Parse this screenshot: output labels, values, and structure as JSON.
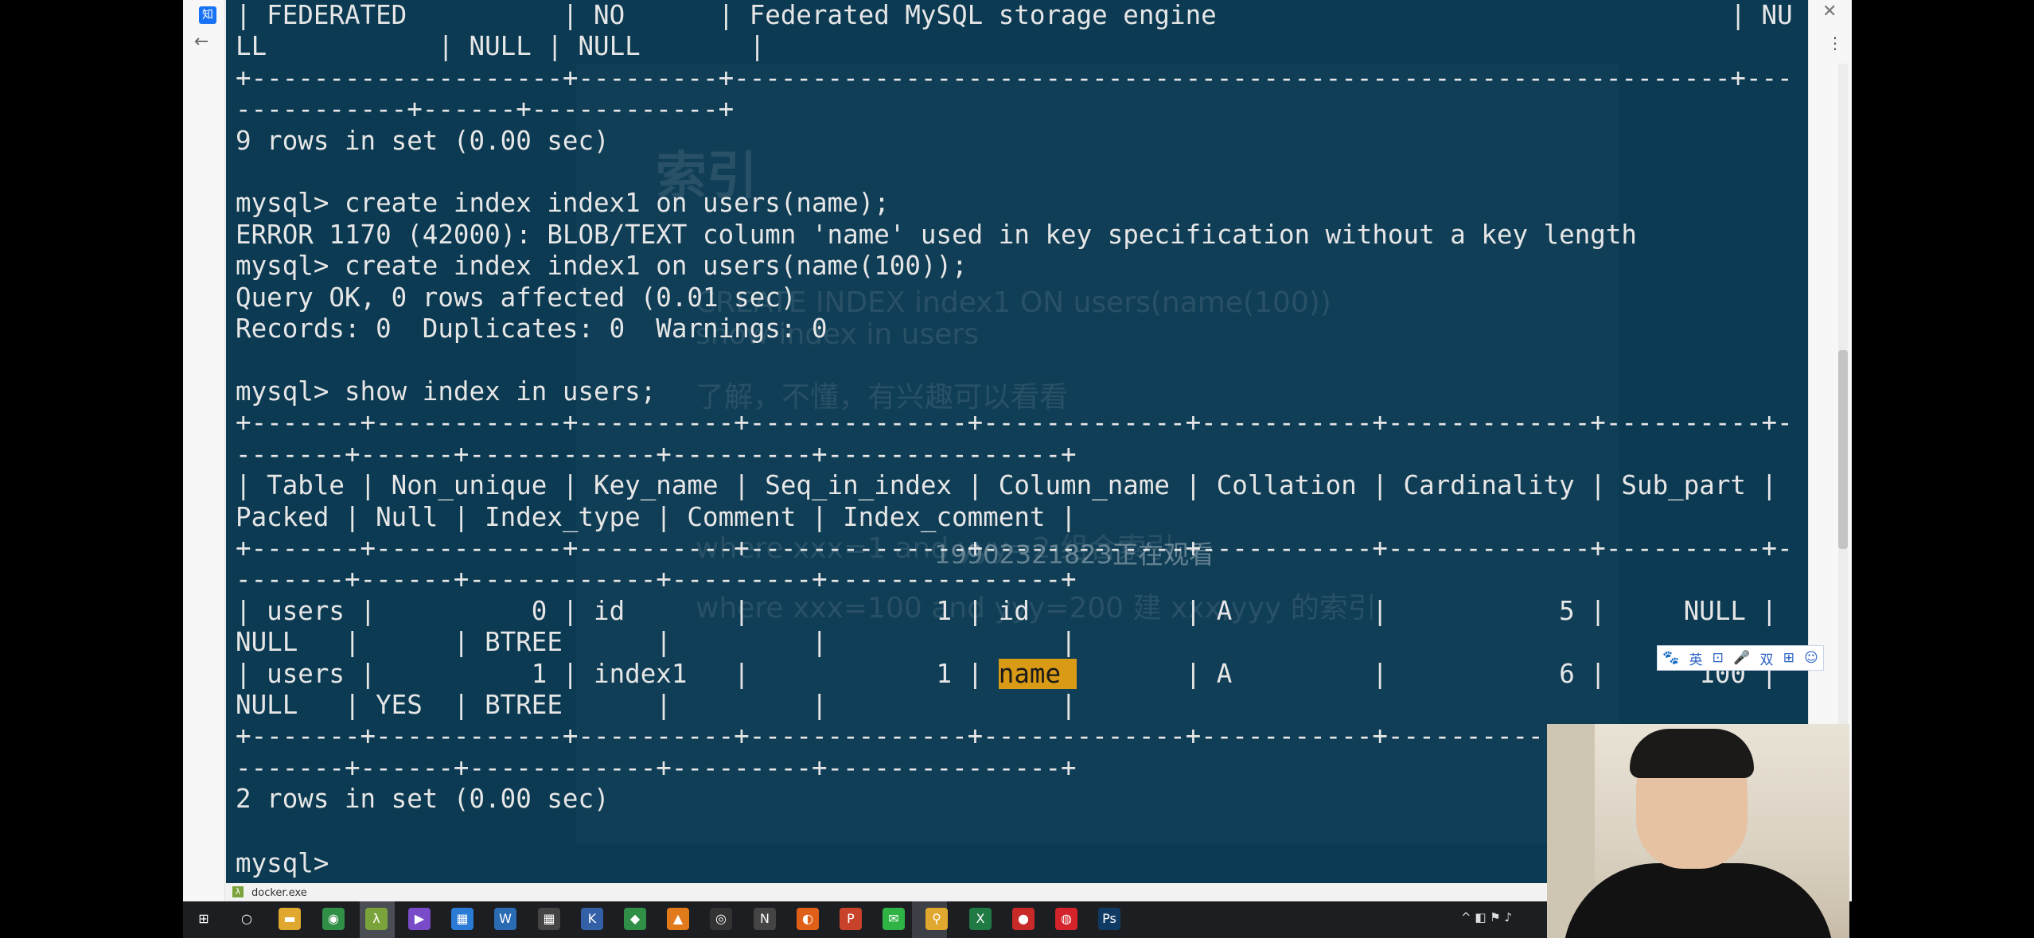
{
  "browser": {
    "back_glyph": "←",
    "close_glyph": "✕",
    "menu_glyph": "⋮",
    "tab_icon_text": "知"
  },
  "terminal": {
    "lines": [
      "| FEDERATED          | NO      | Federated MySQL storage engine                                 | NU",
      "LL           | NULL | NULL       |",
      "+--------------------+---------+----------------------------------------------------------------+---",
      "-----------+------+------------+",
      "9 rows in set (0.00 sec)",
      "",
      "mysql> create index index1 on users(name);",
      "ERROR 1170 (42000): BLOB/TEXT column 'name' used in key specification without a key length",
      "mysql> create index index1 on users(name(100));",
      "Query OK, 0 rows affected (0.01 sec)",
      "Records: 0  Duplicates: 0  Warnings: 0",
      "",
      "mysql> show index in users;",
      "+-------+------------+----------+--------------+-------------+-----------+-------------+----------+-",
      "-------+------+------------+---------+---------------+",
      "| Table | Non_unique | Key_name | Seq_in_index | Column_name | Collation | Cardinality | Sub_part |",
      "Packed | Null | Index_type | Comment | Index_comment |",
      "+-------+------------+----------+--------------+-------------+-----------+-------------+----------+-",
      "-------+------+------------+---------+---------------+",
      "| users |          0 | id       |            1 | id          | A         |           5 |     NULL |",
      "NULL   |      | BTREE      |         |               |",
      "| users |          1 | index1   |            1 | ",
      "NULL   | YES  | BTREE      |         |               |",
      "+-------+------------+----------+--------------+-------------+-----------+-------------+----------+-",
      "-------+------+------------+---------+---------------+",
      "2 rows in set (0.00 sec)",
      "",
      "mysql> "
    ],
    "row_index1_before": "| users |          1 | index1   |            1 | ",
    "row_index1_highlight": "name ",
    "row_index1_after": "       | A         |           6 |      100 |",
    "watermark": "19902321823正在观看",
    "ghost": {
      "title": "索引",
      "line1": "CREATE INDEX index1 ON users(name(100))",
      "line2": "show index in users",
      "line3": "了解，不懂，有兴趣可以看看",
      "line4": "where xxx=1 and yyy=2 组合索引",
      "line5": "where xxx=100 and yyy=200 建 xxx,yyy 的索引"
    }
  },
  "ime": {
    "items": [
      "🐾",
      "英",
      "⊡",
      "🎤",
      "双",
      "⊞",
      "☺"
    ]
  },
  "status_bar": {
    "icon": "λ",
    "title": "docker.exe"
  },
  "taskbar": {
    "items": [
      {
        "name": "windows-start-icon",
        "glyph": "⊞",
        "color": "#1d1e21"
      },
      {
        "name": "search-circle-icon",
        "glyph": "○",
        "color": "#1d1e21"
      },
      {
        "name": "file-explorer-icon",
        "glyph": "▬",
        "color": "#e0a82e"
      },
      {
        "name": "chrome-icon",
        "glyph": "◉",
        "color": "#2f8f46"
      },
      {
        "name": "cmder-icon",
        "glyph": "λ",
        "color": "#7aa33b"
      },
      {
        "name": "visual-studio-icon",
        "glyph": "▶",
        "color": "#7a4bc8"
      },
      {
        "name": "calendar-app-icon",
        "glyph": "▦",
        "color": "#2a7bd6"
      },
      {
        "name": "ws-app-icon",
        "glyph": "W",
        "color": "#2a6bb4"
      },
      {
        "name": "calculator-icon",
        "glyph": "▦",
        "color": "#444"
      },
      {
        "name": "k-app-icon",
        "glyph": "K",
        "color": "#3460a8"
      },
      {
        "name": "game-app-icon",
        "glyph": "◆",
        "color": "#2f8f46"
      },
      {
        "name": "vlc-icon",
        "glyph": "▲",
        "color": "#e07a1a"
      },
      {
        "name": "obs-icon",
        "glyph": "◎",
        "color": "#333"
      },
      {
        "name": "notion-icon",
        "glyph": "N",
        "color": "#444"
      },
      {
        "name": "firefox-icon",
        "glyph": "◐",
        "color": "#e0601a"
      },
      {
        "name": "powerpoint-icon",
        "glyph": "P",
        "color": "#c8432a"
      },
      {
        "name": "wechat-icon",
        "glyph": "✉",
        "color": "#2fb344"
      },
      {
        "name": "search-tool-icon",
        "glyph": "⚲",
        "color": "#e0a82e"
      },
      {
        "name": "excel-icon",
        "glyph": "X",
        "color": "#1f7a44"
      },
      {
        "name": "red-app-icon",
        "glyph": "●",
        "color": "#c82a2a"
      },
      {
        "name": "netease-music-icon",
        "glyph": "◍",
        "color": "#d4232a"
      },
      {
        "name": "photoshop-icon",
        "glyph": "Ps",
        "color": "#0f3a63"
      }
    ],
    "tray_text": "^ ◧ ⚑ ♪"
  }
}
